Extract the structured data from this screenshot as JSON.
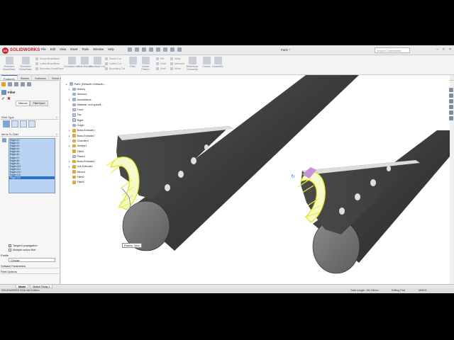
{
  "app": {
    "logo_text": "SOLIDWORKS",
    "doc_title": "Part1 *",
    "search_placeholder": "Search Commands",
    "menu": [
      "File",
      "Edit",
      "View",
      "Insert",
      "Tools",
      "Window",
      "Help"
    ]
  },
  "commands": {
    "large": [
      "Extruded Boss/Base",
      "Revolved Boss/Base",
      "Extruded Cut",
      "Hole Wizard",
      "Revolved Cut",
      "Fillet",
      "Linear Pattern",
      "Draft",
      "Reference Geometry",
      "Curves",
      "Instant3D"
    ],
    "small": [
      "Swept Boss/Base",
      "Lofted Boss/Base",
      "Boundary Boss/Base",
      "Swept Cut",
      "Lofted Cut",
      "Boundary Cut",
      "Rib",
      "Wrap",
      "Shell",
      "Intersect",
      "Mirror"
    ]
  },
  "tabs": [
    "Features",
    "Sketch",
    "Surfaces",
    "Sheet Metal",
    "Evaluate",
    "DimXpert"
  ],
  "property_manager": {
    "title": "Fillet",
    "mode_tabs": [
      "Manual",
      "FilletXpert"
    ],
    "sections": {
      "fillet_type": "Fillet Type",
      "items": "Items To Fillet",
      "parameters": "Fillet Parameters",
      "profile": "Profile",
      "setback": "Setback Parameters",
      "options": "Fillet Options"
    },
    "edges": [
      "Edge<1>",
      "Edge<2>",
      "Edge<3>",
      "Edge<4>",
      "Edge<5>",
      "Edge<6>",
      "Edge<7>",
      "Edge<8>",
      "Edge<9>",
      "Edge<10>",
      "Edge<11>",
      "Edge<12>",
      "Edge<13>",
      "Edge<14>"
    ],
    "tangent_propagation": "Tangent propagation",
    "previews": [
      "Full preview",
      "Partial preview",
      "No preview"
    ],
    "method": "Symmetric",
    "radius": "2.00mm",
    "multiple_radius": "Multiple radius fillet",
    "profile_value": "Circular"
  },
  "tree": {
    "root": "Part1 (Default<<Default>...",
    "items": [
      "History",
      "Sensors",
      "Annotations",
      "Material <not specifi...",
      "Front",
      "Top",
      "Right",
      "Origin",
      "Boss-Extrude1",
      "Boss-Extrude2",
      "Chamfer1",
      "Sweep1",
      "Fillet1",
      "Plane1",
      "Boss-Extrude3",
      "Cut-Extrude1",
      "Mirror1",
      "Fillet2",
      "Fillet3"
    ]
  },
  "viewport": {
    "radius_label": "Radius: 2mm"
  },
  "bottom_tabs": [
    "Model",
    "Motion Study 1"
  ],
  "status": {
    "left": "SOLIDWORKS 2016 x64 Edition",
    "length": "Total Length: 181.93mm",
    "mode": "Editing Part",
    "units": "MMGS"
  },
  "colors": {
    "tube": "#3d3d3d",
    "highlight": "#e8f03a",
    "selection": "#2a6fcf",
    "brand": "#c41e24"
  }
}
